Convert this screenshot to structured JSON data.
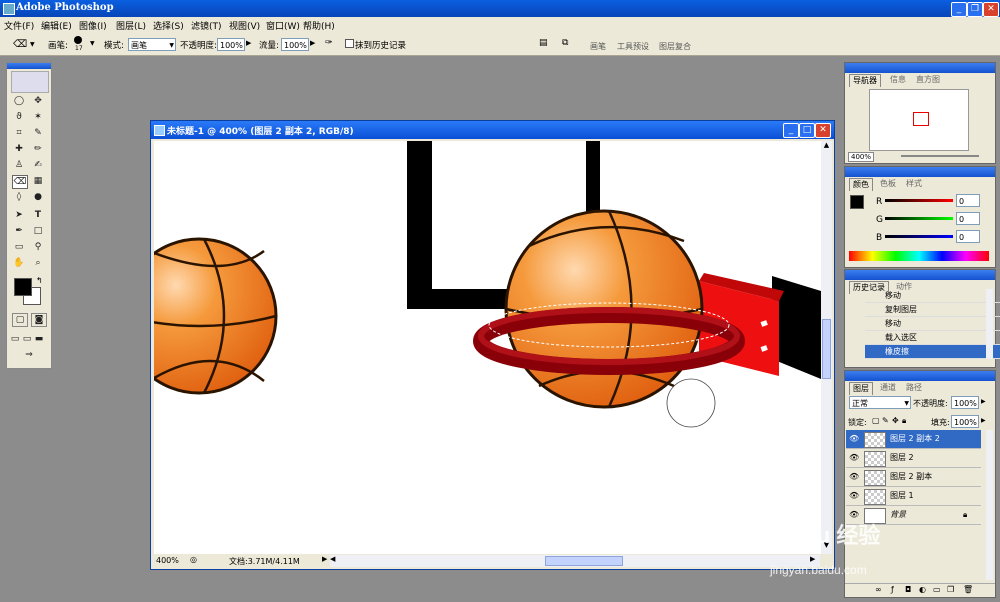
{
  "app": {
    "title": "Adobe Photoshop"
  },
  "menu": [
    "文件(F)",
    "编辑(E)",
    "图像(I)",
    "图层(L)",
    "选择(S)",
    "滤镜(T)",
    "视图(V)",
    "窗口(W)",
    "帮助(H)"
  ],
  "options": {
    "brush_label": "画笔:",
    "brush_size": "17",
    "mode_label": "模式:",
    "mode_value": "画笔",
    "opacity_label": "不透明度:",
    "opacity_value": "100%",
    "flow_label": "流量:",
    "flow_value": "100%",
    "erase_history_label": "抹到历史记录",
    "right_tabs": [
      "画笔",
      "工具预设",
      "图层复合"
    ]
  },
  "document": {
    "title": "未标题-1 @ 400% (图层 2 副本 2, RGB/8)",
    "zoom": "400%",
    "doc_info": "文档:3.71M/4.11M"
  },
  "navigator": {
    "tabs": [
      "导航器",
      "信息",
      "直方图"
    ],
    "zoom": "400%"
  },
  "color": {
    "tabs": [
      "颜色",
      "色板",
      "样式"
    ],
    "r": "0",
    "g": "0",
    "b": "0",
    "r_label": "R",
    "g_label": "G",
    "b_label": "B"
  },
  "history": {
    "tabs": [
      "历史记录",
      "动作"
    ],
    "items": [
      "移动",
      "复制图层",
      "移动",
      "载入选区",
      "橡皮擦"
    ],
    "active_index": 4
  },
  "layers": {
    "tabs": [
      "图层",
      "通道",
      "路径"
    ],
    "blend_mode": "正常",
    "opacity_label": "不透明度:",
    "opacity_value": "100%",
    "lock_label": "锁定:",
    "fill_label": "填充:",
    "fill_value": "100%",
    "items": [
      "图层 2 副本 2",
      "图层 2",
      "图层 2 副本",
      "图层 1",
      "背景"
    ],
    "active_index": 0
  },
  "watermark": {
    "text": "Bai du 经验",
    "url": "jingyan.baidu.com"
  },
  "colors": {
    "titlebar": "#0a55d8",
    "selection": "#316ac5",
    "ball": "#f07010",
    "rim": "#a00010",
    "board": "#ee1010"
  }
}
